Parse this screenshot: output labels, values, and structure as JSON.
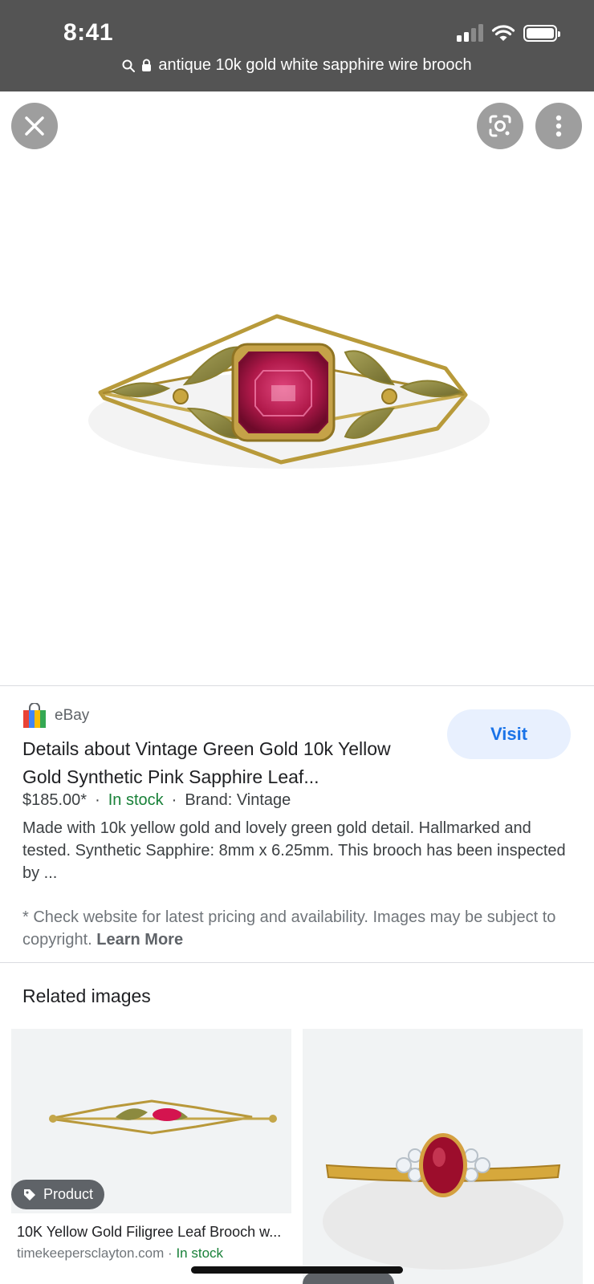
{
  "status_bar": {
    "time": "8:41"
  },
  "url_bar": {
    "query": "antique 10k gold white sapphire wire brooch"
  },
  "viewer": {
    "close_icon": "close-icon",
    "lens_icon": "google-lens-icon",
    "more_icon": "more-vert-icon"
  },
  "result": {
    "source": "eBay",
    "title": "Details about Vintage Green Gold 10k Yellow Gold Synthetic Pink Sapphire Leaf...",
    "price": "$185.00*",
    "sep1": "·",
    "availability": "In stock",
    "sep2": "·",
    "brand": "Brand: Vintage",
    "description": "Made with 10k yellow gold and lovely green gold detail. Hallmarked and tested. Synthetic Sapphire: 8mm x 6.25mm. This brooch has been inspected by ...",
    "visit_label": "Visit",
    "disclaimer": "* Check website for latest pricing and availability. Images may be subject to copyright.",
    "learn_more": "Learn More"
  },
  "related": {
    "heading": "Related images",
    "items": [
      {
        "badge": "Product",
        "caption": "10K Yellow Gold Filigree Leaf Brooch w...",
        "site": "timekeepersclayton.com",
        "sep": "·",
        "availability": "In stock"
      }
    ]
  },
  "colors": {
    "topbar": "#545454",
    "accent": "#1a73e8",
    "in_stock": "#188038",
    "gem": "#b0194a",
    "gold": "#b89a3a"
  }
}
